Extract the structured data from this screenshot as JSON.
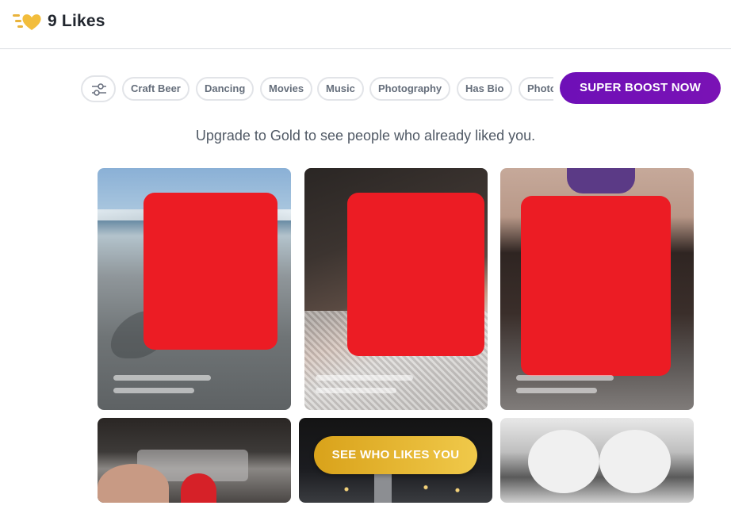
{
  "header": {
    "title": "9 Likes",
    "icon": "gold-heart-likes-icon"
  },
  "filters": {
    "icon": "filter-sliders-icon",
    "chips": [
      "Craft Beer",
      "Dancing",
      "Movies",
      "Music",
      "Photography",
      "Has Bio",
      "Photo"
    ]
  },
  "boost_button": {
    "label": "SUPER BOOST NOW",
    "color": "#6e0fb7"
  },
  "upgrade_message": "Upgrade to Gold to see people who already liked you.",
  "cta_button": {
    "label": "SEE WHO LIKES YOU",
    "color": "#e0ad2a"
  },
  "colors": {
    "redaction": "#ec1c24",
    "accent_gold": "#f0c94a",
    "accent_purple": "#6e0fb7"
  }
}
